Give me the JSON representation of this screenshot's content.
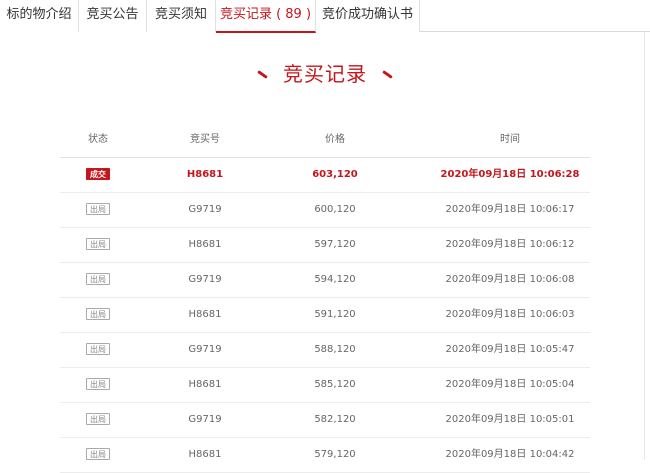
{
  "tabs": [
    {
      "label": "标的物介绍",
      "active": false
    },
    {
      "label": "竞买公告",
      "active": false
    },
    {
      "label": "竞买须知",
      "active": false
    },
    {
      "label": "竞买记录 ( 89 )",
      "active": true
    },
    {
      "label": "竞价成功确认书",
      "active": false
    }
  ],
  "page_title": "竞买记录",
  "columns": {
    "status": "状态",
    "bid_id": "竞买号",
    "price": "价格",
    "time": "时间"
  },
  "records": [
    {
      "status": "成交",
      "bid_id": "H8681",
      "price": "603,120",
      "time": "2020年09月18日 10:06:28",
      "winner": true
    },
    {
      "status": "出局",
      "bid_id": "G9719",
      "price": "600,120",
      "time": "2020年09月18日 10:06:17",
      "winner": false
    },
    {
      "status": "出局",
      "bid_id": "H8681",
      "price": "597,120",
      "time": "2020年09月18日 10:06:12",
      "winner": false
    },
    {
      "status": "出局",
      "bid_id": "G9719",
      "price": "594,120",
      "time": "2020年09月18日 10:06:08",
      "winner": false
    },
    {
      "status": "出局",
      "bid_id": "H8681",
      "price": "591,120",
      "time": "2020年09月18日 10:06:03",
      "winner": false
    },
    {
      "status": "出局",
      "bid_id": "G9719",
      "price": "588,120",
      "time": "2020年09月18日 10:05:47",
      "winner": false
    },
    {
      "status": "出局",
      "bid_id": "H8681",
      "price": "585,120",
      "time": "2020年09月18日 10:05:04",
      "winner": false
    },
    {
      "status": "出局",
      "bid_id": "G9719",
      "price": "582,120",
      "time": "2020年09月18日 10:05:01",
      "winner": false
    },
    {
      "status": "出局",
      "bid_id": "H8681",
      "price": "579,120",
      "time": "2020年09月18日 10:04:42",
      "winner": false
    }
  ],
  "colors": {
    "accent": "#c4161c",
    "text": "#666666",
    "border": "#ececec"
  }
}
